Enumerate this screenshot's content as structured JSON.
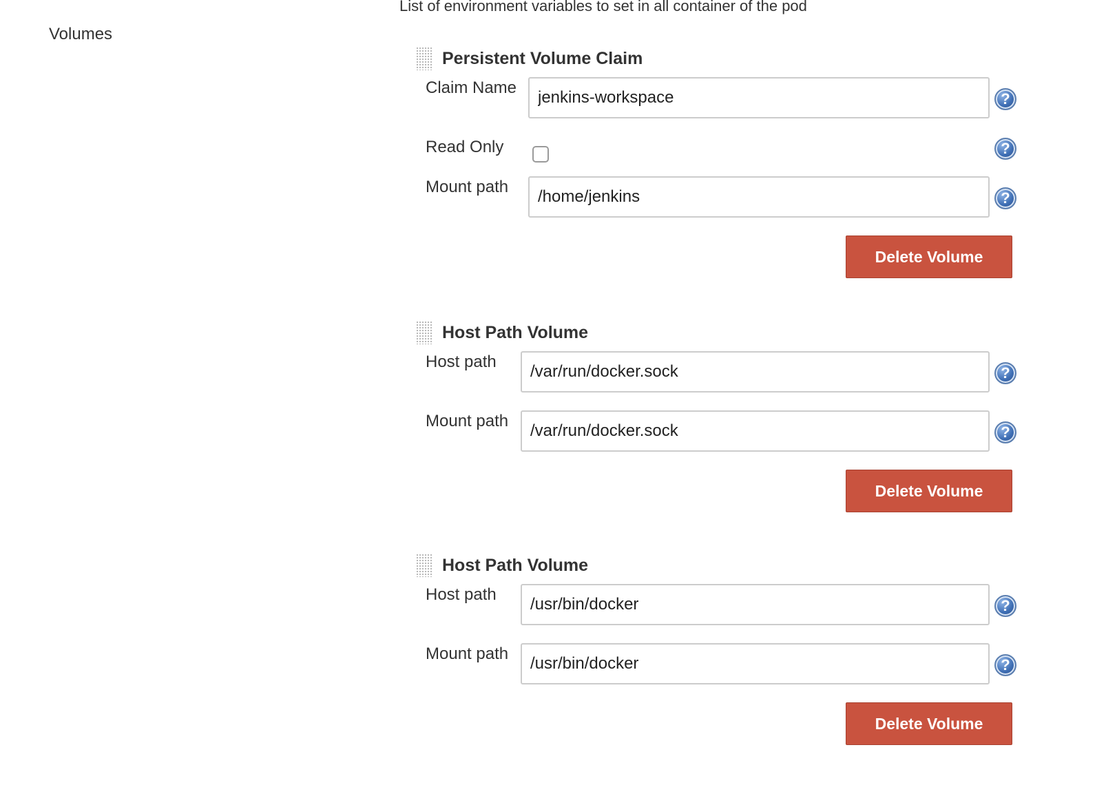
{
  "env_description": "List of environment variables to set in all container of the pod",
  "section_label": "Volumes",
  "help_icon_glyph": "?",
  "volumes": [
    {
      "title": "Persistent Volume Claim",
      "claim_name_label": "Claim Name",
      "claim_name_value": "jenkins-workspace",
      "read_only_label": "Read Only",
      "read_only_checked": false,
      "mount_path_label": "Mount path",
      "mount_path_value": "/home/jenkins",
      "delete_label": "Delete Volume"
    },
    {
      "title": "Host Path Volume",
      "host_path_label": "Host path",
      "host_path_value": "/var/run/docker.sock",
      "mount_path_label": "Mount path",
      "mount_path_value": "/var/run/docker.sock",
      "delete_label": "Delete Volume"
    },
    {
      "title": "Host Path Volume",
      "host_path_label": "Host path",
      "host_path_value": "/usr/bin/docker",
      "mount_path_label": "Mount path",
      "mount_path_value": "/usr/bin/docker",
      "delete_label": "Delete Volume"
    }
  ],
  "colors": {
    "delete_button": "#c9533f",
    "help_icon": "#3f6fb5"
  }
}
